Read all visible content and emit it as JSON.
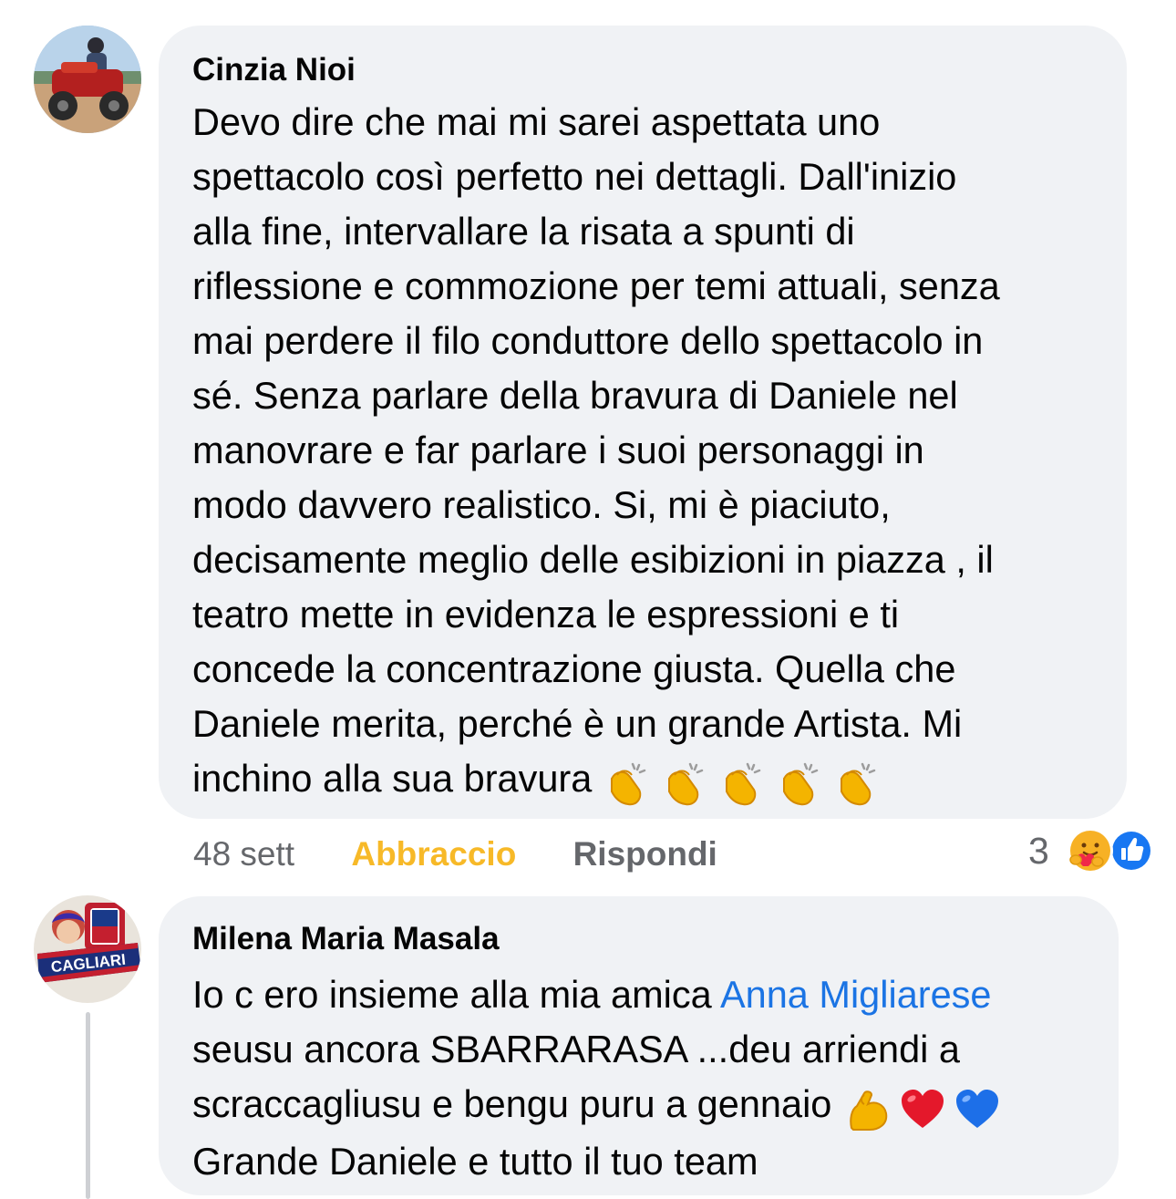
{
  "comments": [
    {
      "author": "Cinzia Nioi",
      "text": "Devo dire che mai mi sarei aspettata uno\nspettacolo così perfetto nei dettagli. Dall'inizio\nalla fine, intervallare la risata a spunti di\nriflessione e commozione per temi attuali, senza\nmai perdere il filo conduttore dello spettacolo in\nsé. Senza parlare della bravura di Daniele nel\nmanovrare e far parlare i suoi personaggi in\nmodo davvero realistico. Si, mi è piaciuto,\ndecisamente meglio delle esibizioni in piazza , il\nteatro mette in evidenza le espressioni e ti\nconcede la concentrazione giusta. Quella che\nDaniele merita, perché è un grande Artista.  Mi\ninchino alla sua bravura",
      "trailing_emojis": [
        "clapping-hands",
        "clapping-hands",
        "clapping-hands",
        "clapping-hands",
        "clapping-hands"
      ],
      "timestamp": "48 sett",
      "reaction_label": "Abbraccio",
      "reply_label": "Rispondi",
      "reaction_count": "3",
      "reaction_icons": [
        "care-hug",
        "like-thumb"
      ]
    },
    {
      "author": "Milena Maria Masala",
      "text_before_mention": "Io c ero insieme alla mia amica ",
      "mention": "Anna Migliarese",
      "text_after_mention": "\nseusu ancora SBARRARASA ...deu arriendi a\nscraccagliusu e bengu puru a gennaio ",
      "inline_emojis": [
        "flexed-biceps",
        "red-heart",
        "blue-heart"
      ],
      "text_end": "\nGrande Daniele e tutto il tuo team",
      "avatar_caption": "CAGLIARI"
    }
  ],
  "colors": {
    "bubble": "#f0f2f5",
    "mention": "#1b74e4",
    "reaction_label": "#f7b928",
    "muted": "#65676b"
  }
}
